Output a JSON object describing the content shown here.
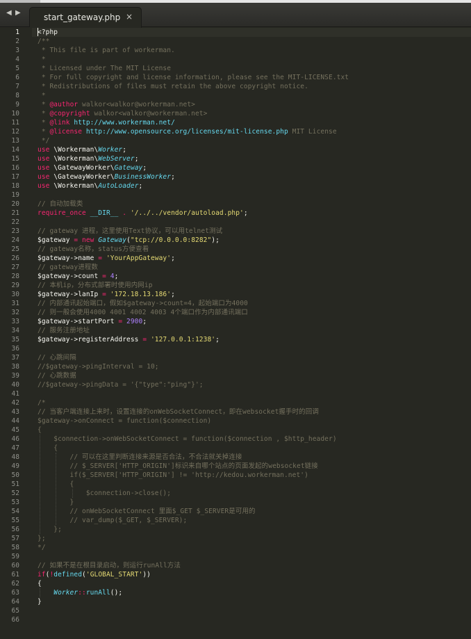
{
  "tab_bar": {
    "back_arrow": "◀",
    "forward_arrow": "▶",
    "active_tab": {
      "title": "start_gateway.php",
      "close_symbol": "×"
    }
  },
  "editor": {
    "current_line": 1,
    "lines": [
      [
        [
          "t",
          "<?php",
          "v"
        ]
      ],
      [
        [
          "t",
          "/**",
          "c"
        ]
      ],
      [
        [
          "t",
          " * This file is part of workerman.",
          "c"
        ]
      ],
      [
        [
          "t",
          " *",
          "c"
        ]
      ],
      [
        [
          "t",
          " * Licensed under The MIT License",
          "c"
        ]
      ],
      [
        [
          "t",
          " * For full copyright and license information, please see the MIT-LICENSE.txt",
          "c"
        ]
      ],
      [
        [
          "t",
          " * Redistributions of files must retain the above copyright notice.",
          "c"
        ]
      ],
      [
        [
          "t",
          " *",
          "c"
        ]
      ],
      [
        [
          "t",
          " * ",
          "c"
        ],
        [
          "t",
          "@author",
          "at"
        ],
        [
          "t",
          " walkor<walkor@workerman.net>",
          "c"
        ]
      ],
      [
        [
          "t",
          " * ",
          "c"
        ],
        [
          "t",
          "@copyright",
          "at"
        ],
        [
          "t",
          " walkor<walkor@workerman.net>",
          "c"
        ]
      ],
      [
        [
          "t",
          " * ",
          "c"
        ],
        [
          "t",
          "@link",
          "at"
        ],
        [
          "t",
          " http://www.workerman.net/",
          "u"
        ]
      ],
      [
        [
          "t",
          " * ",
          "c"
        ],
        [
          "t",
          "@license",
          "at"
        ],
        [
          "t",
          " http://www.opensource.org/licenses/mit-license.php",
          "u"
        ],
        [
          "t",
          " MIT License",
          "c"
        ]
      ],
      [
        [
          "t",
          " */",
          "c"
        ]
      ],
      [
        [
          "t",
          "use",
          "k"
        ],
        [
          "t",
          " \\Workerman\\",
          "v"
        ],
        [
          "t",
          "Worker",
          "t"
        ],
        [
          "t",
          ";",
          "v"
        ]
      ],
      [
        [
          "t",
          "use",
          "k"
        ],
        [
          "t",
          " \\Workerman\\",
          "v"
        ],
        [
          "t",
          "WebServer",
          "t"
        ],
        [
          "t",
          ";",
          "v"
        ]
      ],
      [
        [
          "t",
          "use",
          "k"
        ],
        [
          "t",
          " \\GatewayWorker\\",
          "v"
        ],
        [
          "t",
          "Gateway",
          "t"
        ],
        [
          "t",
          ";",
          "v"
        ]
      ],
      [
        [
          "t",
          "use",
          "k"
        ],
        [
          "t",
          " \\GatewayWorker\\",
          "v"
        ],
        [
          "t",
          "BusinessWorker",
          "t"
        ],
        [
          "t",
          ";",
          "v"
        ]
      ],
      [
        [
          "t",
          "use",
          "k"
        ],
        [
          "t",
          " \\Workerman\\",
          "v"
        ],
        [
          "t",
          "AutoLoader",
          "t"
        ],
        [
          "t",
          ";",
          "v"
        ]
      ],
      [],
      [
        [
          "t",
          "// 自动加载类",
          "c"
        ]
      ],
      [
        [
          "t",
          "require_once",
          "k"
        ],
        [
          "t",
          " ",
          "v"
        ],
        [
          "t",
          "__DIR__",
          "f"
        ],
        [
          "t",
          " ",
          "v"
        ],
        [
          "t",
          ".",
          "k"
        ],
        [
          "t",
          " ",
          "v"
        ],
        [
          "t",
          "'/../../vendor/autoload.php'",
          "s"
        ],
        [
          "t",
          ";",
          "v"
        ]
      ],
      [],
      [
        [
          "t",
          "// gateway 进程，这里使用Text协议，可以用telnet测试",
          "c"
        ]
      ],
      [
        [
          "t",
          "$gateway",
          "v"
        ],
        [
          "t",
          " = ",
          "k"
        ],
        [
          "t",
          "new",
          "k"
        ],
        [
          "t",
          " ",
          "v"
        ],
        [
          "t",
          "Gateway",
          "t"
        ],
        [
          "t",
          "(",
          "v"
        ],
        [
          "t",
          "\"tcp://0.0.0.0:8282\"",
          "s"
        ],
        [
          "t",
          ");",
          "v"
        ]
      ],
      [
        [
          "t",
          "// gateway名称，status方便查看",
          "c"
        ]
      ],
      [
        [
          "t",
          "$gateway->name",
          "v"
        ],
        [
          "t",
          " = ",
          "k"
        ],
        [
          "t",
          "'YourAppGateway'",
          "s"
        ],
        [
          "t",
          ";",
          "v"
        ]
      ],
      [
        [
          "t",
          "// gateway进程数",
          "c"
        ]
      ],
      [
        [
          "t",
          "$gateway->count",
          "v"
        ],
        [
          "t",
          " = ",
          "k"
        ],
        [
          "t",
          "4",
          "n"
        ],
        [
          "t",
          ";",
          "v"
        ]
      ],
      [
        [
          "t",
          "// 本机ip，分布式部署时使用内网ip",
          "c"
        ]
      ],
      [
        [
          "t",
          "$gateway->lanIp",
          "v"
        ],
        [
          "t",
          " = ",
          "k"
        ],
        [
          "t",
          "'172.18.13.186'",
          "s"
        ],
        [
          "t",
          ";",
          "v"
        ]
      ],
      [
        [
          "t",
          "// 内部通讯起始端口，假如$gateway->count=4，起始端口为4000",
          "c"
        ]
      ],
      [
        [
          "t",
          "// 则一般会使用4000 4001 4002 4003 4个端口作为内部通讯端口",
          "c"
        ]
      ],
      [
        [
          "t",
          "$gateway->startPort",
          "v"
        ],
        [
          "t",
          " = ",
          "k"
        ],
        [
          "t",
          "2900",
          "n"
        ],
        [
          "t",
          ";",
          "v"
        ]
      ],
      [
        [
          "t",
          "// 服务注册地址",
          "c"
        ]
      ],
      [
        [
          "t",
          "$gateway->registerAddress",
          "v"
        ],
        [
          "t",
          " = ",
          "k"
        ],
        [
          "t",
          "'127.0.0.1:1238'",
          "s"
        ],
        [
          "t",
          ";",
          "v"
        ]
      ],
      [],
      [
        [
          "t",
          "// 心跳间隔",
          "c"
        ]
      ],
      [
        [
          "t",
          "//$gateway->pingInterval = 10;",
          "c"
        ]
      ],
      [
        [
          "t",
          "// 心跳数据",
          "c"
        ]
      ],
      [
        [
          "t",
          "//$gateway->pingData = '{\"type\":\"ping\"}';",
          "c"
        ]
      ],
      [],
      [
        [
          "t",
          "/*",
          "c"
        ]
      ],
      [
        [
          "t",
          "// 当客户端连接上来时，设置连接的onWebSocketConnect，即在websocket握手时的回调",
          "c"
        ]
      ],
      [
        [
          "t",
          "$gateway->onConnect = function($connection)",
          "c"
        ]
      ],
      [
        [
          "t",
          "{",
          "c"
        ]
      ],
      [
        [
          "t",
          "    $connection->onWebSocketConnect = function($connection , $http_header)",
          "c"
        ]
      ],
      [
        [
          "t",
          "    {",
          "c"
        ]
      ],
      [
        [
          "t",
          "        // 可以在这里判断连接来源是否合法，不合法就关掉连接",
          "c"
        ]
      ],
      [
        [
          "t",
          "        // $_SERVER['HTTP_ORIGIN']标识来自哪个站点的页面发起的websocket链接",
          "c"
        ]
      ],
      [
        [
          "t",
          "        if($_SERVER['HTTP_ORIGIN'] != 'http://kedou.workerman.net')",
          "c"
        ]
      ],
      [
        [
          "t",
          "        {",
          "c"
        ]
      ],
      [
        [
          "t",
          "            $connection->close();",
          "c"
        ]
      ],
      [
        [
          "t",
          "        }",
          "c"
        ]
      ],
      [
        [
          "t",
          "        // onWebSocketConnect 里面$_GET $_SERVER是可用的",
          "c"
        ]
      ],
      [
        [
          "t",
          "        // var_dump($_GET, $_SERVER);",
          "c"
        ]
      ],
      [
        [
          "t",
          "    };",
          "c"
        ]
      ],
      [
        [
          "t",
          "};",
          "c"
        ]
      ],
      [
        [
          "t",
          "*/",
          "c"
        ]
      ],
      [],
      [
        [
          "t",
          "// 如果不是在根目录启动，则运行runAll方法",
          "c"
        ]
      ],
      [
        [
          "t",
          "if",
          "k"
        ],
        [
          "t",
          "(",
          "v"
        ],
        [
          "t",
          "!",
          "k"
        ],
        [
          "t",
          "defined",
          "f"
        ],
        [
          "t",
          "(",
          "v"
        ],
        [
          "t",
          "'GLOBAL_START'",
          "s"
        ],
        [
          "t",
          "))",
          "v"
        ]
      ],
      [
        [
          "t",
          "{",
          "v"
        ]
      ],
      [
        [
          "t",
          "    ",
          "v"
        ],
        [
          "t",
          "Worker",
          "t"
        ],
        [
          "t",
          "::",
          "k"
        ],
        [
          "t",
          "runAll",
          "f"
        ],
        [
          "t",
          "();",
          "v"
        ]
      ],
      [
        [
          "t",
          "}",
          "v"
        ]
      ],
      [],
      []
    ]
  },
  "colors": {
    "background": "#272822",
    "comment": "#75715e",
    "keyword": "#f92672",
    "string": "#e6db74",
    "number": "#ae81ff",
    "type": "#66d9ef"
  }
}
